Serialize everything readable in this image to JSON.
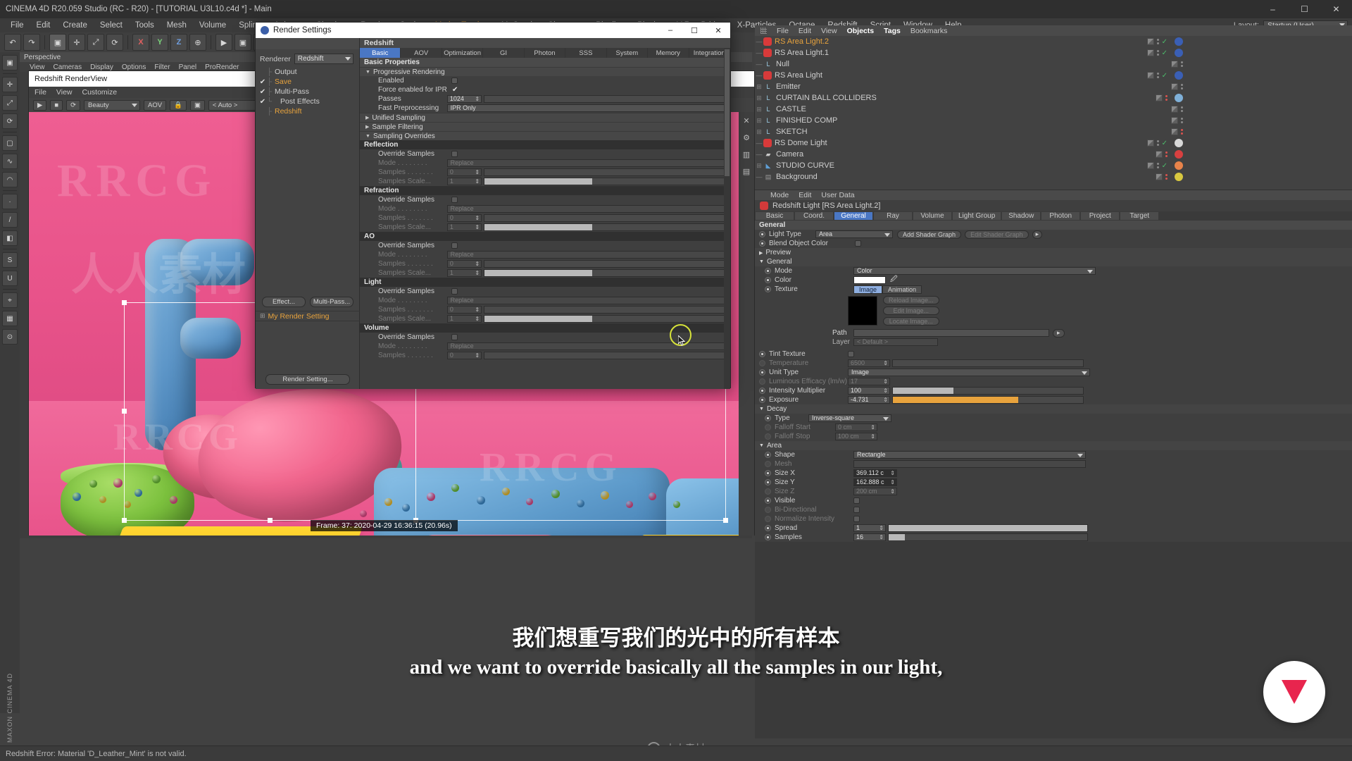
{
  "window": {
    "title": "CINEMA 4D R20.059 Studio (RC - R20) - [TUTORIAL U3L10.c4d *] - Main",
    "minimize": "–",
    "maximize": "☐",
    "close": "✕"
  },
  "menubar": {
    "items": [
      {
        "label": "File"
      },
      {
        "label": "Edit"
      },
      {
        "label": "Create"
      },
      {
        "label": "Select"
      },
      {
        "label": "Tools"
      },
      {
        "label": "Mesh"
      },
      {
        "label": "Volume"
      },
      {
        "label": "Spline"
      },
      {
        "label": "Animate"
      },
      {
        "label": "Simulate"
      },
      {
        "label": "Render"
      },
      {
        "label": "Sculpt"
      },
      {
        "label": "Motion Tracker",
        "highlight": true
      },
      {
        "label": "MoGraph"
      },
      {
        "label": "Character"
      },
      {
        "label": "Pipeline"
      },
      {
        "label": "Plugins"
      },
      {
        "label": "V-Ray Bridge"
      },
      {
        "label": "X-Particles"
      },
      {
        "label": "Octane"
      },
      {
        "label": "Redshift"
      },
      {
        "label": "Script"
      },
      {
        "label": "Window"
      },
      {
        "label": "Help"
      }
    ],
    "layout_label": "Layout:",
    "layout_value": "Startup (User)"
  },
  "toolbar": {
    "undo": "↶",
    "redo": "↷",
    "select": "▣",
    "move": "✛",
    "scale": "⤢",
    "rotate": "⟳",
    "axis_x": "X",
    "axis_y": "Y",
    "axis_z": "Z",
    "world": "⊕",
    "render_view": "▶",
    "render_region": "▣",
    "render_settings": "⚙"
  },
  "left_palette": {
    "items": [
      "live-selection-icon",
      "move-icon",
      "scale-icon",
      "rotate-icon",
      "cube-icon",
      "spline-icon",
      "array-icon",
      "deformer-icon",
      "light-icon",
      "camera-icon",
      "material-icon",
      "uv-icon",
      "point-icon",
      "edge-icon",
      "polygon-icon",
      "axis-icon"
    ]
  },
  "viewport": {
    "tab": "Perspective",
    "menu": [
      "View",
      "Cameras",
      "Display",
      "Options",
      "Filter",
      "Panel",
      "ProRender"
    ]
  },
  "render_view": {
    "title": "Redshift RenderView",
    "menu": [
      "File",
      "View",
      "Customize"
    ],
    "pass_value": "Beauty",
    "ratio_value": "< Auto >",
    "frame_info": "Frame: 37: 2020-04-29  16:36:15 (20.96s)"
  },
  "render_settings": {
    "title": "Render Settings",
    "renderer_label": "Renderer",
    "renderer_value": "Redshift",
    "tree": [
      {
        "label": "Output",
        "checked": false,
        "orange": false
      },
      {
        "label": "Save",
        "checked": true,
        "orange": true
      },
      {
        "label": "Multi-Pass",
        "checked": true,
        "orange": false
      },
      {
        "label": "Post Effects",
        "checked": true,
        "orange": false,
        "indent": true
      },
      {
        "label": "Redshift",
        "checked": false,
        "orange": true
      }
    ],
    "effect_button": "Effect...",
    "multipass_button": "Multi-Pass...",
    "my_render_setting": "My Render Setting",
    "render_setting_button": "Render Setting...",
    "panel_title": "Redshift",
    "tabs": [
      {
        "label": "Basic",
        "active": true
      },
      {
        "label": "AOV",
        "active": false
      },
      {
        "label": "Optimization",
        "active": false
      },
      {
        "label": "GI",
        "active": false
      },
      {
        "label": "Photon",
        "active": false
      },
      {
        "label": "SSS",
        "active": false
      },
      {
        "label": "System",
        "active": false
      },
      {
        "label": "Memory",
        "active": false
      },
      {
        "label": "Integration",
        "active": false
      }
    ],
    "section_title": "Basic Properties",
    "progressive": {
      "group": "Progressive Rendering",
      "enabled_label": "Enabled",
      "enabled_checked": false,
      "force_ipr_label": "Force enabled for IPR",
      "force_ipr_checked": true,
      "passes_label": "Passes",
      "passes_value": "1024",
      "fast_pre_label": "Fast Preprocessing",
      "fast_pre_value": "IPR Only"
    },
    "collapsed_groups": [
      "Unified Sampling",
      "Sample Filtering"
    ],
    "overrides_group": "Sampling Overrides",
    "override_blocks": [
      {
        "name": "Reflection",
        "override_label": "Override Samples",
        "override_checked": false,
        "mode_label": "Mode",
        "mode_value": "Replace",
        "samples_label": "Samples",
        "samples_value": "0",
        "scale_label": "Samples Scale...",
        "scale_value": "1",
        "scale_fill": 44
      },
      {
        "name": "Refraction",
        "override_label": "Override Samples",
        "override_checked": false,
        "mode_label": "Mode",
        "mode_value": "Replace",
        "samples_label": "Samples",
        "samples_value": "0",
        "scale_label": "Samples Scale...",
        "scale_value": "1",
        "scale_fill": 44
      },
      {
        "name": "AO",
        "override_label": "Override Samples",
        "override_checked": false,
        "mode_label": "Mode",
        "mode_value": "Replace",
        "samples_label": "Samples",
        "samples_value": "0",
        "scale_label": "Samples Scale...",
        "scale_value": "1",
        "scale_fill": 44
      },
      {
        "name": "Light",
        "override_label": "Override Samples",
        "override_checked": false,
        "mode_label": "Mode",
        "mode_value": "Replace",
        "samples_label": "Samples",
        "samples_value": "0",
        "scale_label": "Samples Scale...",
        "scale_value": "1",
        "scale_fill": 44
      },
      {
        "name": "Volume",
        "override_label": "Override Samples",
        "override_checked": false,
        "mode_label": "Mode",
        "mode_value": "Replace",
        "samples_label": "Samples",
        "samples_value": "0",
        "scale_label": "",
        "scale_value": "",
        "scale_fill": 0
      }
    ]
  },
  "object_manager": {
    "menu": [
      "File",
      "Edit",
      "View",
      "Objects",
      "Tags",
      "Bookmarks"
    ],
    "menu_highlight": [
      "Objects",
      "Tags"
    ],
    "objects": [
      {
        "name": "RS Area Light.2",
        "type": "light",
        "selected": true,
        "expand": false,
        "visible": true,
        "tag": "area"
      },
      {
        "name": "RS Area Light.1",
        "type": "light",
        "selected": false,
        "expand": false,
        "visible": true,
        "tag": "area"
      },
      {
        "name": "Null",
        "type": "null",
        "selected": false,
        "expand": false,
        "visible": false,
        "tag": ""
      },
      {
        "name": "RS Area Light",
        "type": "light",
        "selected": false,
        "expand": false,
        "visible": true,
        "tag": "area"
      },
      {
        "name": "Emitter",
        "type": "null",
        "selected": false,
        "expand": true,
        "visible": false,
        "tag": ""
      },
      {
        "name": "CURTAIN BALL COLLIDERS",
        "type": "null",
        "selected": false,
        "expand": true,
        "visible": false,
        "tag": "dyn"
      },
      {
        "name": "CASTLE",
        "type": "null",
        "selected": false,
        "expand": true,
        "visible": false,
        "tag": ""
      },
      {
        "name": "FINISHED COMP",
        "type": "null",
        "selected": false,
        "expand": true,
        "visible": false,
        "tag": ""
      },
      {
        "name": "SKETCH",
        "type": "null",
        "selected": false,
        "expand": true,
        "visible": false,
        "tag": ""
      },
      {
        "name": "RS Dome Light",
        "type": "light",
        "selected": false,
        "expand": false,
        "visible": true,
        "tag": "dome"
      },
      {
        "name": "Camera",
        "type": "camera",
        "selected": false,
        "expand": false,
        "visible": false,
        "tag": "cam"
      },
      {
        "name": "STUDIO CURVE",
        "type": "mesh",
        "selected": false,
        "expand": true,
        "visible": true,
        "tag": "mat"
      },
      {
        "name": "Background",
        "type": "bg",
        "selected": false,
        "expand": false,
        "visible": false,
        "tag": "bg"
      }
    ]
  },
  "attribute_manager": {
    "menu": [
      "Mode",
      "Edit",
      "User Data"
    ],
    "object_title": "Redshift Light [RS Area Light.2]",
    "tabs": [
      {
        "label": "Basic",
        "active": false
      },
      {
        "label": "Coord.",
        "active": false
      },
      {
        "label": "General",
        "active": true
      },
      {
        "label": "Ray",
        "active": false
      },
      {
        "label": "Volume",
        "active": false
      },
      {
        "label": "Light Group",
        "active": false
      },
      {
        "label": "Shadow",
        "active": false
      },
      {
        "label": "Photon",
        "active": false
      },
      {
        "label": "Project",
        "active": false
      },
      {
        "label": "Target",
        "active": false
      }
    ],
    "general_header": "General",
    "light_type_label": "Light Type",
    "light_type_value": "Area",
    "add_shader_graph": "Add Shader Graph",
    "edit_shader_graph": "Edit Shader Graph",
    "blend_object_color_label": "Blend Object Color",
    "blend_object_color_checked": false,
    "preview_group": "Preview",
    "general_group": "General",
    "mode_label": "Mode",
    "mode_value": "Color",
    "color_label": "Color",
    "color_value": "#ffffff",
    "texture_label": "Texture",
    "texture_tabs": [
      {
        "label": "Image",
        "active": true
      },
      {
        "label": "Animation",
        "active": false
      }
    ],
    "reload_image": "Reload Image...",
    "edit_image": "Edit Image...",
    "locate_image": "Locate Image...",
    "path_label": "Path",
    "path_value": "",
    "layer_label": "Layer",
    "layer_value": "< Default >",
    "tint_texture_label": "Tint Texture",
    "tint_texture_checked": false,
    "temperature_label": "Temperature",
    "temperature_value": "6500",
    "unit_type_label": "Unit Type",
    "unit_type_value": "Image",
    "luminous_efficacy_label": "Luminous Efficacy (lm/w)",
    "luminous_efficacy_value": "17",
    "intensity_multiplier_label": "Intensity Multiplier",
    "intensity_multiplier_value": "100",
    "exposure_label": "Exposure",
    "exposure_value": "-4.731",
    "decay_group": "Decay",
    "decay_type_label": "Type",
    "decay_type_value": "Inverse-square",
    "falloff_start_label": "Falloff Start",
    "falloff_start_value": "0 cm",
    "falloff_stop_label": "Falloff Stop",
    "falloff_stop_value": "100 cm",
    "area_group": "Area",
    "shape_label": "Shape",
    "shape_value": "Rectangle",
    "mesh_label": "Mesh",
    "mesh_value": "",
    "size_x_label": "Size X",
    "size_x_value": "369.112 c",
    "size_y_label": "Size Y",
    "size_y_value": "162.888 c",
    "size_z_label": "Size Z",
    "size_z_value": "200 cm",
    "visible_label": "Visible",
    "visible_checked": false,
    "bidirectional_label": "Bi-Directional",
    "bidirectional_checked": false,
    "normalize_label": "Normalize Intensity",
    "normalize_checked": false,
    "spread_label": "Spread",
    "spread_value": "1",
    "samples_label": "Samples",
    "samples_value": "16"
  },
  "subtitles": {
    "chinese": "我们想重写我们的光中的所有样本",
    "english": "and we want to override basically all the samples in our light,"
  },
  "status_bar": {
    "message": "Redshift Error: Material 'D_Leather_Mint' is not valid."
  },
  "side_label": "MAXON CINEMA 4D",
  "colors": {
    "accent_blue": "#4a77c4",
    "orange": "#e8a33d",
    "highlight_yellow": "#d6e23a",
    "pink_bg": "#e8538a"
  },
  "watermarks": [
    "人人素材",
    "RRCG"
  ]
}
